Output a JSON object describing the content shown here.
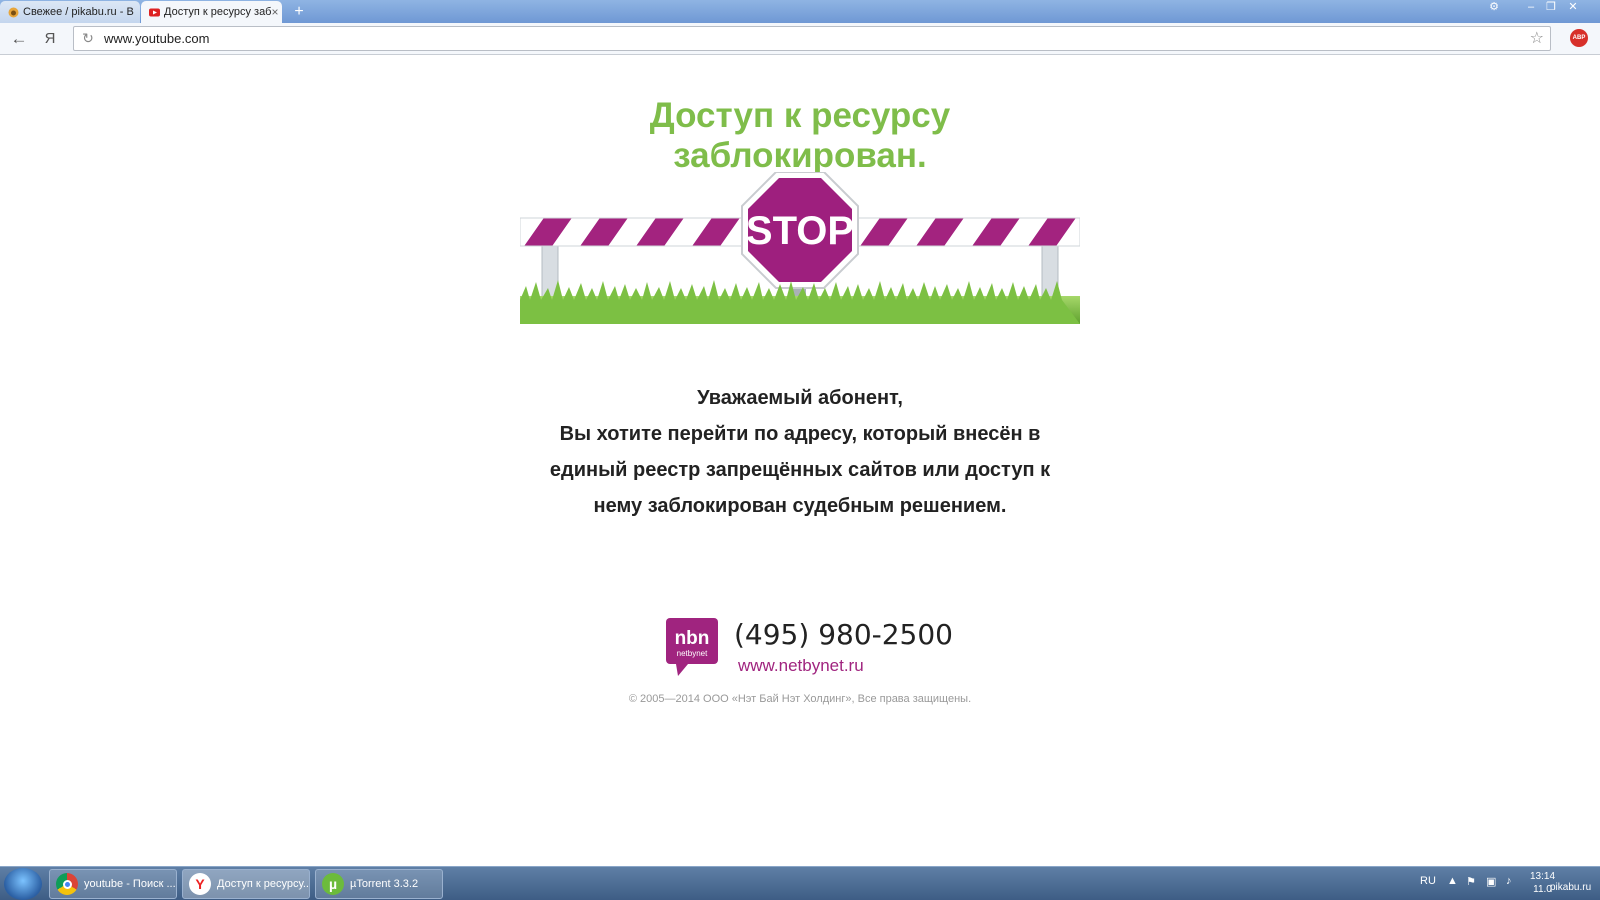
{
  "browser": {
    "tabs": [
      {
        "title": "Свежее / pikabu.ru - В",
        "active": false
      },
      {
        "title": "Доступ к ресурсу заб",
        "active": true
      }
    ],
    "new_tab_glyph": "+",
    "close_glyph": "×",
    "address": "www.youtube.com",
    "yandex_glyph": "Я",
    "abp_label": "ABP"
  },
  "page": {
    "headline": "Доступ к ресурсу заблокирован.",
    "stop_sign_text": "STOP",
    "message_lines": [
      "Уважаемый абонент,",
      "Вы хотите перейти по адресу, который внесён в",
      "единый реестр запрещённых сайтов или доступ к",
      "нему заблокирован судебным решением."
    ],
    "logo_text": "nbn",
    "logo_subtext": "netbynet",
    "phone": "(495) 980-2500",
    "website": "www.netbynet.ru",
    "copyright": "© 2005—2014 ООО «Нэт Бай Нэт Холдинг», Все права защищены.",
    "colors": {
      "headline": "#7fbd4a",
      "brand": "#a0247f"
    }
  },
  "taskbar": {
    "tasks": [
      {
        "label": "youtube - Поиск ...",
        "icon": "chrome-icon"
      },
      {
        "label": "Доступ к ресурсу...",
        "icon": "yandex-icon"
      },
      {
        "label": "µTorrent 3.3.2",
        "icon": "utorrent-icon"
      }
    ],
    "language": "RU",
    "clock_time": "13:14",
    "clock_date": "11.0",
    "watermark": "pikabu.ru"
  }
}
